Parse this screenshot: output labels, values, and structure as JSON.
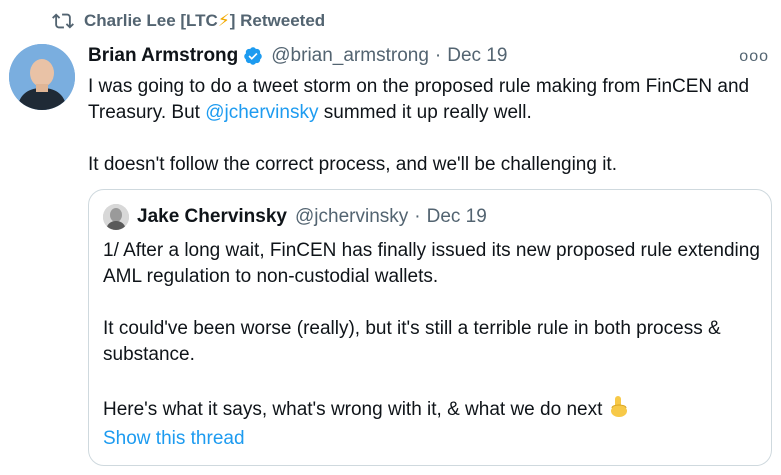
{
  "retweet": {
    "icon": "retweet-icon",
    "user": "Charlie Lee [LTC",
    "bolt": "⚡",
    "suffix": "] Retweeted"
  },
  "tweet": {
    "author_name": "Brian Armstrong",
    "verified_icon": "verified-badge-icon",
    "handle": "@brian_armstrong",
    "dot": "·",
    "date": "Dec 19",
    "more": "ooo",
    "line1_a": "I was going to do a tweet storm on the proposed rule making from FinCEN and Treasury. But ",
    "line1_mention": "@jchervinsky",
    "line1_b": " summed it up really well.",
    "line2": "It doesn't follow the correct process, and we'll be challenging it."
  },
  "quote": {
    "author_name": "Jake Chervinsky",
    "handle": "@jchervinsky",
    "dot": "·",
    "date": "Dec 19",
    "para1": "1/ After a long wait, FinCEN has finally issued its new proposed rule extending AML regulation to non-custodial wallets.",
    "para2": "It could've been worse (really), but it's still a terrible rule in both process & substance.",
    "para3": "Here's what it says, what's wrong with it, & what we do next",
    "pointing_icon": "pointing-down-icon",
    "show_thread": "Show this thread"
  },
  "colors": {
    "link": "#1d9bf0",
    "secondary_text": "#536471",
    "border": "#cfd9de",
    "bolt": "#f2a900"
  }
}
